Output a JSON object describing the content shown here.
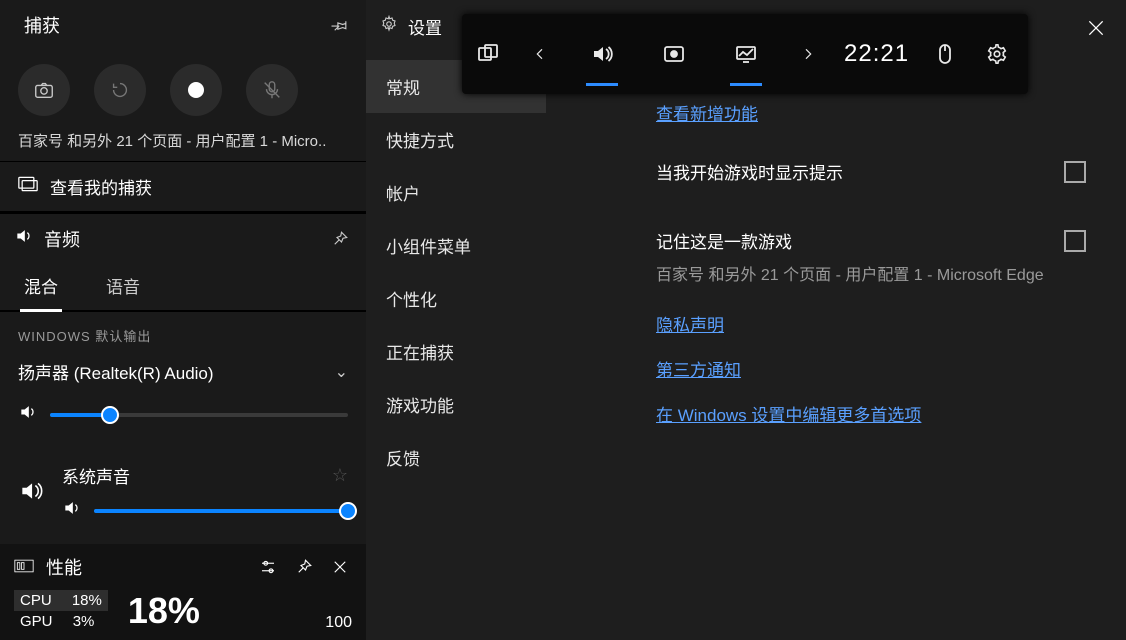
{
  "capture": {
    "title": "捕获",
    "window_title": "百家号 和另外 21 个页面 - 用户配置 1 - Micro..",
    "view_captures": "查看我的捕获"
  },
  "audio": {
    "title": "音频",
    "tab_mix": "混合",
    "tab_voice": "语音",
    "default_out_label": "WINDOWS 默认输出",
    "device": "扬声器 (Realtek(R) Audio)",
    "system_sound": "系统声音"
  },
  "perf": {
    "title": "性能",
    "cpu_label": "CPU",
    "cpu_val": "18%",
    "gpu_label": "GPU",
    "gpu_val": "3%",
    "big": "18%",
    "right": "100"
  },
  "toolbar": {
    "time": "22:21"
  },
  "settings": {
    "title": "设置",
    "nav": {
      "general": "常规",
      "shortcuts": "快捷方式",
      "account": "帐户",
      "widgets": "小组件菜单",
      "personalize": "个性化",
      "capturing": "正在捕获",
      "gaming": "游戏功能",
      "feedback": "反馈"
    },
    "main": {
      "whats_new": "查看新增功能",
      "tip_label": "当我开始游戏时显示提示",
      "remember_label": "记住这是一款游戏",
      "remember_sub": "百家号 和另外 21 个页面 - 用户配置 1 - Microsoft Edge",
      "privacy": "隐私声明",
      "third_party": "第三方通知",
      "win_settings": "在 Windows 设置中编辑更多首选项"
    }
  }
}
